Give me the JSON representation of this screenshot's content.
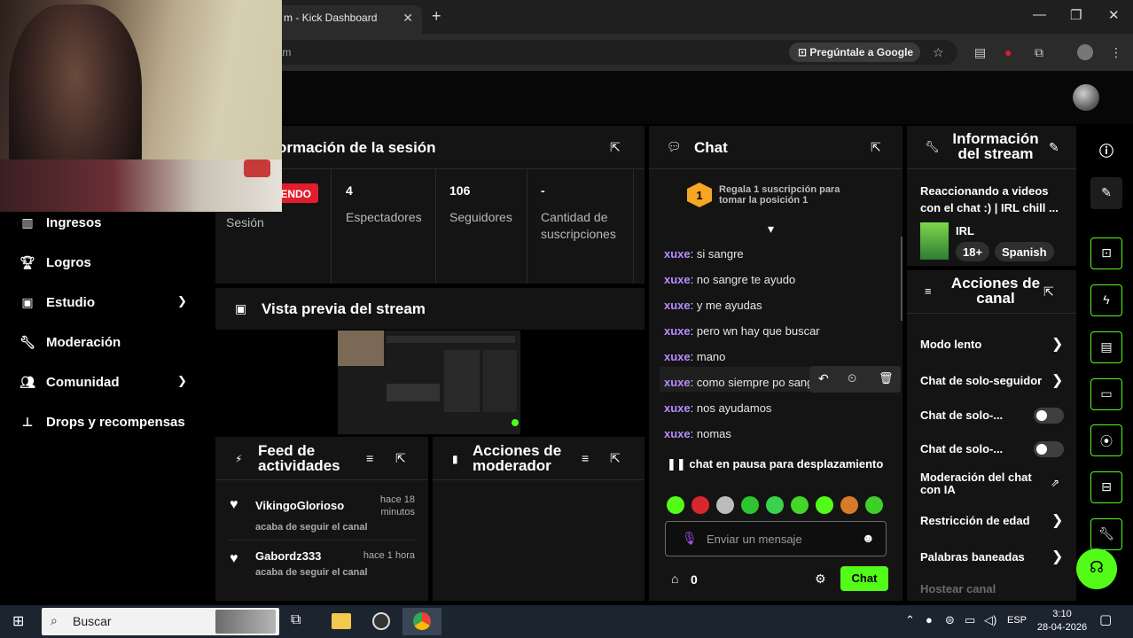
{
  "browser": {
    "tab_title": "m - Kick Dashboard",
    "address_fragment": "eam",
    "ask_google": "Pregúntale a Google"
  },
  "nav": {
    "items": [
      {
        "label": "Ingresos",
        "icon": "bar-chart-icon"
      },
      {
        "label": "Logros",
        "icon": "trophy-icon"
      },
      {
        "label": "Estudio",
        "icon": "studio-icon",
        "expandable": true
      },
      {
        "label": "Moderación",
        "icon": "wrench-icon"
      },
      {
        "label": "Comunidad",
        "icon": "users-icon",
        "expandable": true
      },
      {
        "label": "Drops y recompensas",
        "icon": "drops-icon"
      }
    ]
  },
  "session": {
    "title": "ormación de la sesión",
    "live_badge": "IENDO",
    "session_label": "Sesión",
    "stats": [
      {
        "value": "4",
        "label": "Espectadores"
      },
      {
        "value": "106",
        "label": "Seguidores"
      },
      {
        "value": "-",
        "label": "Cantidad de suscripciones"
      }
    ]
  },
  "preview": {
    "title": "Vista previa del stream"
  },
  "feed": {
    "title": "Feed de actividades",
    "items": [
      {
        "user": "VikingoGlorioso",
        "time": "hace 18 minutos",
        "action": "acaba de seguir el canal"
      },
      {
        "user": "Gabordz333",
        "time": "hace 1 hora",
        "action": "acaba de seguir el canal"
      }
    ]
  },
  "mod_actions": {
    "title": "Acciones de moderador"
  },
  "chat": {
    "title": "Chat",
    "gift_rank": "1",
    "gift_text": "Regala 1 suscripción para tomar la posición 1",
    "messages": [
      {
        "user": "xuxe",
        "text": "si sangre"
      },
      {
        "user": "xuxe",
        "text": "no sangre te ayudo"
      },
      {
        "user": "xuxe",
        "text": "y me ayudas"
      },
      {
        "user": "xuxe",
        "text": "pero wn hay que buscar"
      },
      {
        "user": "xuxe",
        "text": "mano"
      },
      {
        "user": "xuxe",
        "text": "como siempre po sang"
      },
      {
        "user": "xuxe",
        "text": "nos ayudamos"
      },
      {
        "user": "xuxe",
        "text": "nomas"
      }
    ],
    "paused_text": "chat en pausa para desplazamiento",
    "input_placeholder": "Enviar un mensaje",
    "points": "0",
    "send_label": "Chat"
  },
  "stream_info": {
    "title": "Información del stream",
    "stream_title": "Reaccionando a videos con el chat :) | IRL chill ...",
    "category": "IRL",
    "tags": [
      "18+",
      "Spanish"
    ]
  },
  "channel_actions": {
    "title": "Acciones de canal",
    "items": [
      {
        "label": "Modo lento",
        "control": "chevron"
      },
      {
        "label": "Chat de solo-seguidor",
        "control": "chevron"
      },
      {
        "label": "Chat de solo-...",
        "control": "toggle"
      },
      {
        "label": "Chat de solo-...",
        "control": "toggle"
      },
      {
        "label": "Moderación del chat con IA",
        "control": "external"
      },
      {
        "label": "Restricción de edad",
        "control": "chevron"
      },
      {
        "label": "Palabras baneadas",
        "control": "chevron"
      },
      {
        "label": "Hostear canal",
        "control": "none"
      }
    ]
  },
  "taskbar": {
    "search_label": "Buscar",
    "lang": "ESP",
    "time": "3:10",
    "date": "28-04-2026"
  },
  "colors": {
    "kick_green": "#53fc18",
    "live_red": "#e11d2e",
    "username": "#b98cff",
    "panel": "#141414"
  }
}
